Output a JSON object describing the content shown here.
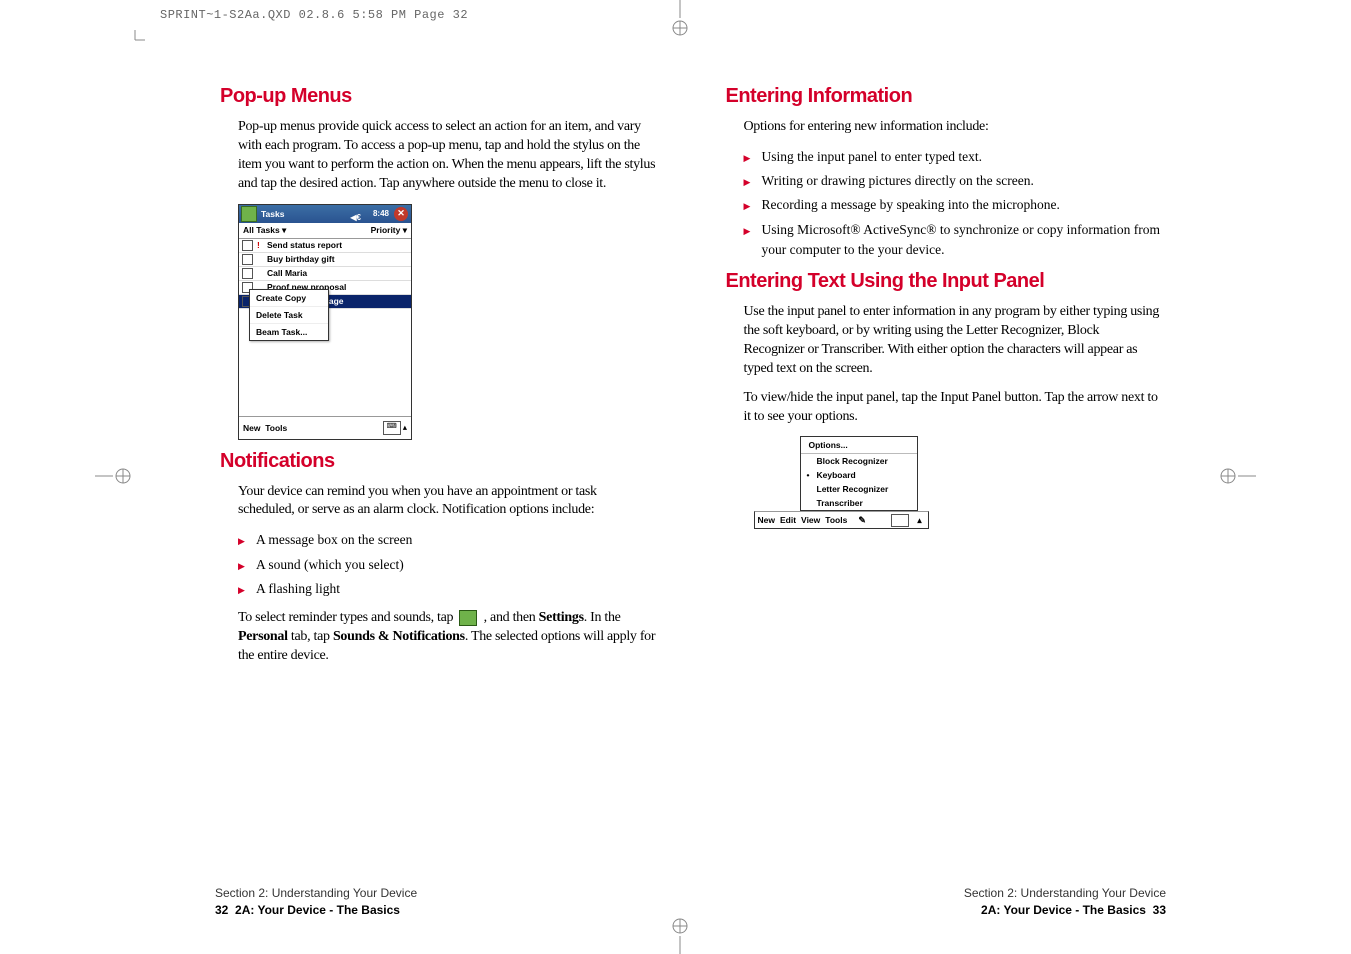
{
  "header": "SPRINT~1-S2Aa.QXD  02.8.6  5:58 PM  Page 32",
  "left": {
    "h1": "Pop-up Menus",
    "p1": "Pop-up menus provide quick access to select an action for an item, and vary with each program. To access a pop-up menu, tap and hold the stylus on the item you want to perform the action on. When the menu appears, lift the stylus and tap the desired action. Tap anywhere outside the menu to close it.",
    "h2": "Notifications",
    "p2": "Your device can remind you when you have an appointment or task scheduled, or serve as an alarm clock. Notification options include:",
    "bullets1": [
      "A message box on the screen",
      "A sound (which you select)",
      "A flashing light"
    ],
    "p3a": "To select reminder types and sounds, tap ",
    "p3b": " , and then ",
    "p3c": ". In the ",
    "p3d": " tab, tap ",
    "p3e": ". The selected options will apply for the entire device.",
    "bold_settings": "Settings",
    "bold_personal": "Personal",
    "bold_sounds": "Sounds & Notifications"
  },
  "right": {
    "h1": "Entering Information",
    "p1": "Options for entering new information include:",
    "bullets1": [
      "Using the input panel to enter typed text.",
      "Writing or drawing pictures directly on the screen.",
      "Recording a message by speaking into the microphone.",
      "Using Microsoft® ActiveSync® to synchronize or copy information from your computer to the your device."
    ],
    "h2": "Entering Text Using the Input Panel",
    "p2": "Use the input panel to enter information in any program by either typing using the soft keyboard, or by writing using the Letter Recognizer, Block Recognizer or Transcriber. With either option the characters will appear as typed text on the screen.",
    "p3": "To view/hide the input panel, tap the Input Panel button. Tap the arrow next to it to see your options."
  },
  "ss1": {
    "title": "Tasks",
    "time": "8:48",
    "all": "All Tasks ▾",
    "priority": "Priority ▾",
    "rows": [
      {
        "pri": "!",
        "txt": "Send status report"
      },
      {
        "pri": "",
        "txt": "Buy birthday gift"
      },
      {
        "pri": "",
        "txt": "Call Maria"
      },
      {
        "pri": "",
        "txt": "Proof new proposal"
      },
      {
        "pri": "",
        "txt": "Schedule massage",
        "hi": true
      }
    ],
    "popup": [
      "Create Copy",
      "Delete Task",
      "Beam Task..."
    ],
    "new": "New",
    "tools": "Tools"
  },
  "ss2": {
    "options": "Options...",
    "items": [
      {
        "t": "Block Recognizer",
        "sel": false
      },
      {
        "t": "Keyboard",
        "sel": true
      },
      {
        "t": "Letter Recognizer",
        "sel": false
      },
      {
        "t": "Transcriber",
        "sel": false
      }
    ],
    "menubar": [
      "New",
      "Edit",
      "View",
      "Tools"
    ],
    "arrow": "▴"
  },
  "footer": {
    "section": "Section 2: Understanding Your Device",
    "sub": "2A: Your Device - The Basics",
    "pL": "32",
    "pR": "33"
  }
}
